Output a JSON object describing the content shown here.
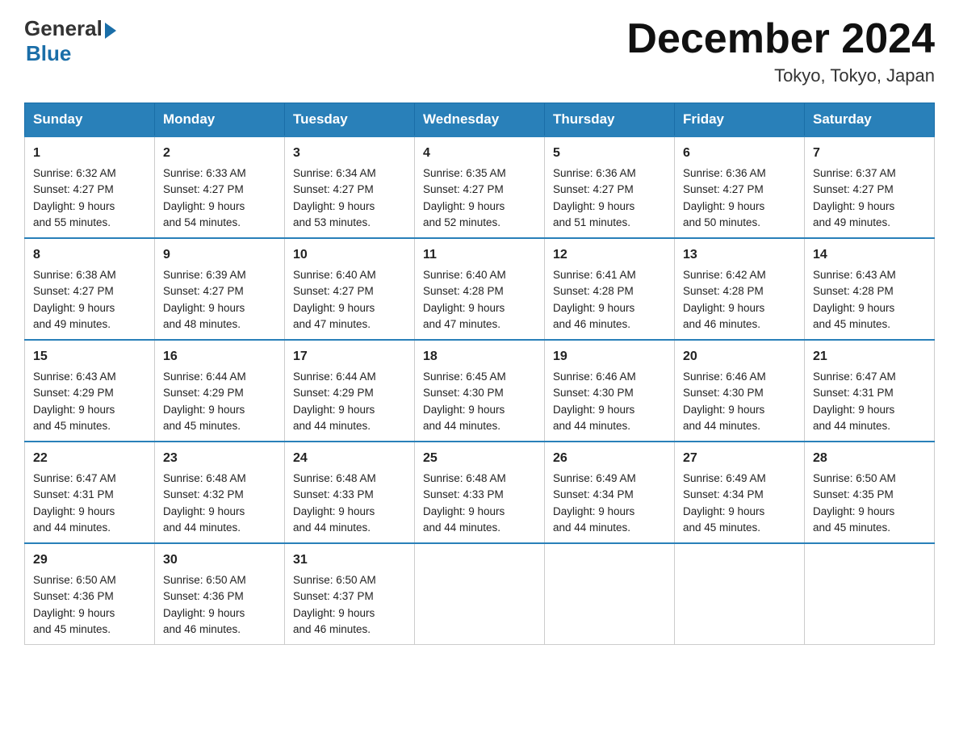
{
  "header": {
    "logo_general": "General",
    "logo_blue": "Blue",
    "month_year": "December 2024",
    "location": "Tokyo, Tokyo, Japan"
  },
  "days_of_week": [
    "Sunday",
    "Monday",
    "Tuesday",
    "Wednesday",
    "Thursday",
    "Friday",
    "Saturday"
  ],
  "weeks": [
    [
      {
        "day": "1",
        "sunrise": "6:32 AM",
        "sunset": "4:27 PM",
        "daylight": "9 hours and 55 minutes."
      },
      {
        "day": "2",
        "sunrise": "6:33 AM",
        "sunset": "4:27 PM",
        "daylight": "9 hours and 54 minutes."
      },
      {
        "day": "3",
        "sunrise": "6:34 AM",
        "sunset": "4:27 PM",
        "daylight": "9 hours and 53 minutes."
      },
      {
        "day": "4",
        "sunrise": "6:35 AM",
        "sunset": "4:27 PM",
        "daylight": "9 hours and 52 minutes."
      },
      {
        "day": "5",
        "sunrise": "6:36 AM",
        "sunset": "4:27 PM",
        "daylight": "9 hours and 51 minutes."
      },
      {
        "day": "6",
        "sunrise": "6:36 AM",
        "sunset": "4:27 PM",
        "daylight": "9 hours and 50 minutes."
      },
      {
        "day": "7",
        "sunrise": "6:37 AM",
        "sunset": "4:27 PM",
        "daylight": "9 hours and 49 minutes."
      }
    ],
    [
      {
        "day": "8",
        "sunrise": "6:38 AM",
        "sunset": "4:27 PM",
        "daylight": "9 hours and 49 minutes."
      },
      {
        "day": "9",
        "sunrise": "6:39 AM",
        "sunset": "4:27 PM",
        "daylight": "9 hours and 48 minutes."
      },
      {
        "day": "10",
        "sunrise": "6:40 AM",
        "sunset": "4:27 PM",
        "daylight": "9 hours and 47 minutes."
      },
      {
        "day": "11",
        "sunrise": "6:40 AM",
        "sunset": "4:28 PM",
        "daylight": "9 hours and 47 minutes."
      },
      {
        "day": "12",
        "sunrise": "6:41 AM",
        "sunset": "4:28 PM",
        "daylight": "9 hours and 46 minutes."
      },
      {
        "day": "13",
        "sunrise": "6:42 AM",
        "sunset": "4:28 PM",
        "daylight": "9 hours and 46 minutes."
      },
      {
        "day": "14",
        "sunrise": "6:43 AM",
        "sunset": "4:28 PM",
        "daylight": "9 hours and 45 minutes."
      }
    ],
    [
      {
        "day": "15",
        "sunrise": "6:43 AM",
        "sunset": "4:29 PM",
        "daylight": "9 hours and 45 minutes."
      },
      {
        "day": "16",
        "sunrise": "6:44 AM",
        "sunset": "4:29 PM",
        "daylight": "9 hours and 45 minutes."
      },
      {
        "day": "17",
        "sunrise": "6:44 AM",
        "sunset": "4:29 PM",
        "daylight": "9 hours and 44 minutes."
      },
      {
        "day": "18",
        "sunrise": "6:45 AM",
        "sunset": "4:30 PM",
        "daylight": "9 hours and 44 minutes."
      },
      {
        "day": "19",
        "sunrise": "6:46 AM",
        "sunset": "4:30 PM",
        "daylight": "9 hours and 44 minutes."
      },
      {
        "day": "20",
        "sunrise": "6:46 AM",
        "sunset": "4:30 PM",
        "daylight": "9 hours and 44 minutes."
      },
      {
        "day": "21",
        "sunrise": "6:47 AM",
        "sunset": "4:31 PM",
        "daylight": "9 hours and 44 minutes."
      }
    ],
    [
      {
        "day": "22",
        "sunrise": "6:47 AM",
        "sunset": "4:31 PM",
        "daylight": "9 hours and 44 minutes."
      },
      {
        "day": "23",
        "sunrise": "6:48 AM",
        "sunset": "4:32 PM",
        "daylight": "9 hours and 44 minutes."
      },
      {
        "day": "24",
        "sunrise": "6:48 AM",
        "sunset": "4:33 PM",
        "daylight": "9 hours and 44 minutes."
      },
      {
        "day": "25",
        "sunrise": "6:48 AM",
        "sunset": "4:33 PM",
        "daylight": "9 hours and 44 minutes."
      },
      {
        "day": "26",
        "sunrise": "6:49 AM",
        "sunset": "4:34 PM",
        "daylight": "9 hours and 44 minutes."
      },
      {
        "day": "27",
        "sunrise": "6:49 AM",
        "sunset": "4:34 PM",
        "daylight": "9 hours and 45 minutes."
      },
      {
        "day": "28",
        "sunrise": "6:50 AM",
        "sunset": "4:35 PM",
        "daylight": "9 hours and 45 minutes."
      }
    ],
    [
      {
        "day": "29",
        "sunrise": "6:50 AM",
        "sunset": "4:36 PM",
        "daylight": "9 hours and 45 minutes."
      },
      {
        "day": "30",
        "sunrise": "6:50 AM",
        "sunset": "4:36 PM",
        "daylight": "9 hours and 46 minutes."
      },
      {
        "day": "31",
        "sunrise": "6:50 AM",
        "sunset": "4:37 PM",
        "daylight": "9 hours and 46 minutes."
      },
      null,
      null,
      null,
      null
    ]
  ],
  "labels": {
    "sunrise": "Sunrise:",
    "sunset": "Sunset:",
    "daylight": "Daylight:"
  },
  "colors": {
    "header_bg": "#2980b9",
    "border_blue": "#2980b9"
  }
}
